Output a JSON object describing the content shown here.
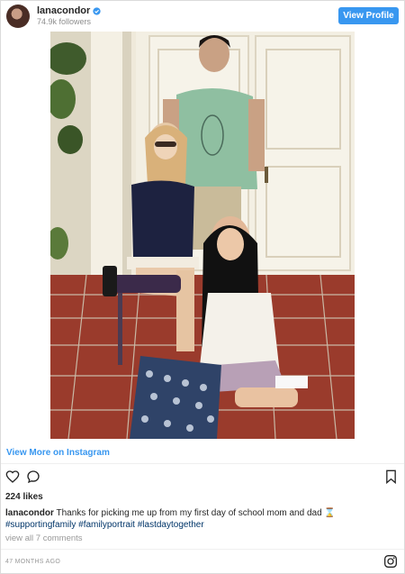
{
  "header": {
    "username": "lanacondor",
    "followers": "74.9k followers",
    "view_profile_label": "View Profile",
    "avatar_icon": "avatar"
  },
  "post": {
    "image_icon": "photo"
  },
  "view_more_label": "View More on Instagram",
  "actions": {
    "like_icon": "heart-icon",
    "comment_icon": "comment-icon",
    "save_icon": "bookmark-icon"
  },
  "likes": "224 likes",
  "caption": {
    "username": "lanacondor",
    "text": "Thanks for picking me up from my first day of school mom and dad ",
    "emoji": "⌛",
    "tags": [
      "#supportingfamily",
      "#familyportrait",
      "#lastdaytogether"
    ]
  },
  "view_comments": "view all 7 comments",
  "time_ago": "47 MONTHS AGO",
  "colors": {
    "accent": "#3897f0",
    "text": "#262626",
    "muted": "#999999",
    "hashtag": "#003569"
  }
}
